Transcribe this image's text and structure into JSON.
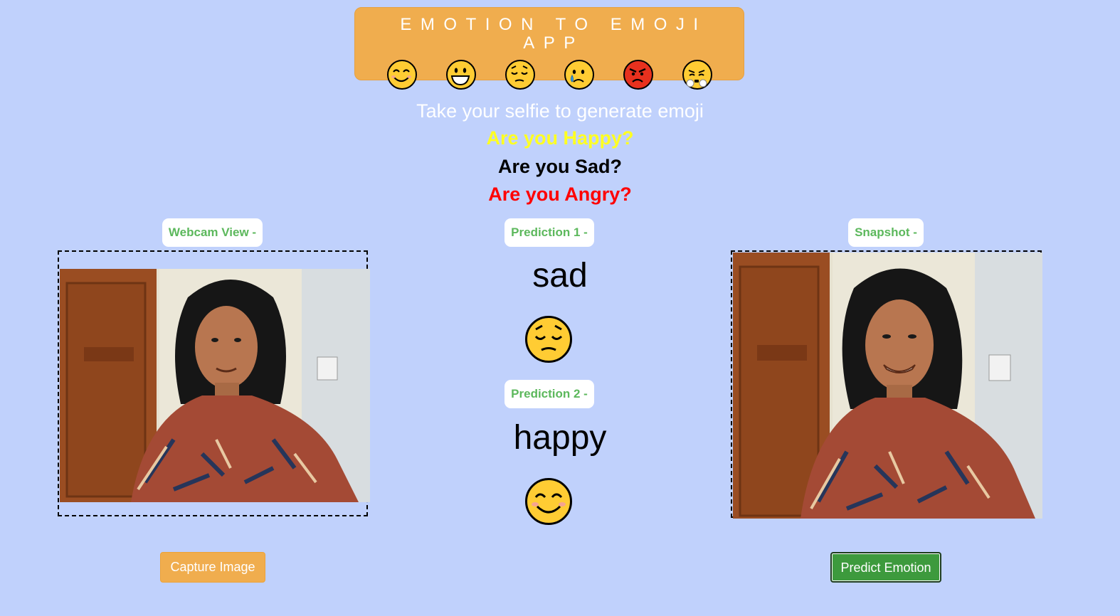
{
  "header": {
    "title": "EMOTION TO EMOJI APP",
    "emojis": [
      "smiling-face-icon",
      "grinning-face-icon",
      "pensive-face-icon",
      "crying-face-icon",
      "angry-face-icon",
      "steam-face-icon"
    ]
  },
  "intro": {
    "line1": "Take your selfie to generate emoji",
    "line2": "Are you Happy?",
    "line3": "Are you Sad?",
    "line4": "Are you Angry?"
  },
  "webcam": {
    "label": "Webcam View -"
  },
  "snapshot": {
    "label": "Snapshot -"
  },
  "predictions": [
    {
      "label": "Prediction 1 -",
      "emotion": "sad",
      "emoji": "pensive-face-icon"
    },
    {
      "label": "Prediction 2 -",
      "emotion": "happy",
      "emoji": "smiling-face-icon"
    }
  ],
  "buttons": {
    "capture": "Capture Image",
    "predict": "Predict Emotion"
  },
  "colors": {
    "background": "#c0d1fc",
    "banner": "#f0ad4e",
    "label_text": "#5cb85c",
    "predict_button": "#3d9a3d",
    "happy_text": "#ffff22",
    "angry_text": "#ff0000"
  }
}
